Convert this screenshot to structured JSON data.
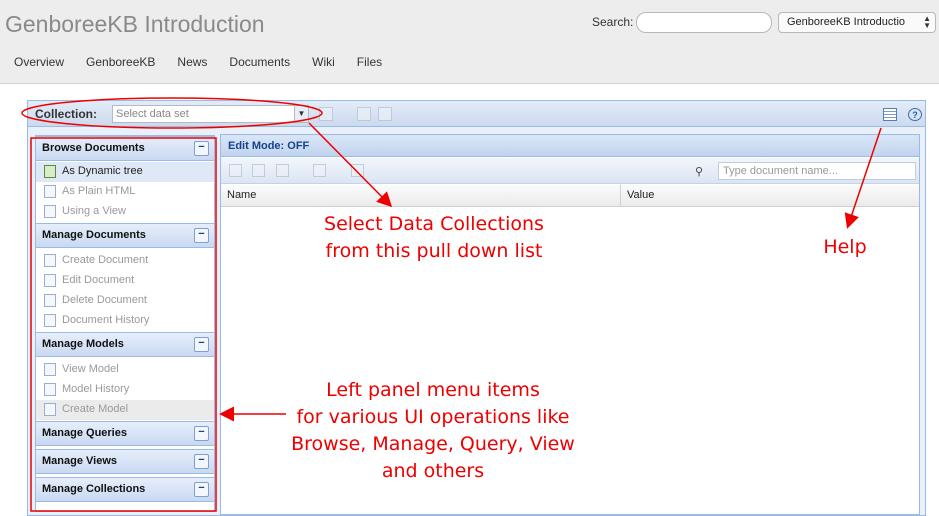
{
  "header": {
    "title": "GenboreeKB Introduction",
    "search_label": "Search:",
    "search_value": "",
    "project_select_value": "GenboreeKB Introductio"
  },
  "nav": [
    "Overview",
    "GenboreeKB",
    "News",
    "Documents",
    "Wiki",
    "Files"
  ],
  "collection_bar": {
    "label": "Collection:",
    "select_placeholder": "Select data set"
  },
  "sidebar": {
    "browse": {
      "title": "Browse Documents",
      "items": [
        "As Dynamic tree",
        "As Plain HTML",
        "Using a View"
      ]
    },
    "manage_documents": {
      "title": "Manage Documents",
      "items": [
        "Create Document",
        "Edit Document",
        "Delete Document",
        "Document History"
      ]
    },
    "manage_models": {
      "title": "Manage Models",
      "items": [
        "View Model",
        "Model History",
        "Create Model"
      ]
    },
    "manage_queries": {
      "title": "Manage Queries"
    },
    "manage_views": {
      "title": "Manage Views"
    },
    "manage_collections": {
      "title": "Manage Collections"
    },
    "collapse_glyph": "−"
  },
  "grid": {
    "edit_mode": "Edit Mode: OFF",
    "doc_search_placeholder": "Type document name...",
    "columns": [
      "Name",
      "Value"
    ]
  },
  "annotations": {
    "select_collections": [
      "Select Data Collections",
      "from this pull down list"
    ],
    "help": "Help",
    "left_panel": [
      "Left panel menu items",
      "for various UI operations like",
      "Browse, Manage, Query, View",
      "and others"
    ]
  },
  "colors": {
    "annotation_red": "#ee0000",
    "panel_border": "#99bbe8",
    "header_text": "#15428b"
  }
}
